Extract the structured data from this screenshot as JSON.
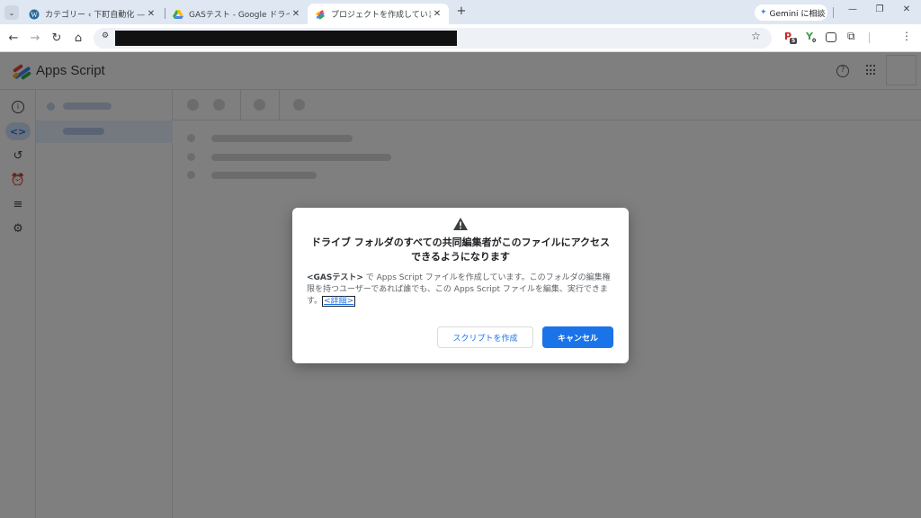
{
  "browser": {
    "tabs": [
      {
        "title": "カテゴリー ‹ 下町自動化 — WordPress",
        "icon": "wordpress-icon",
        "active": false
      },
      {
        "title": "GASテスト - Google ドライブ",
        "icon": "google-drive-icon",
        "active": false
      },
      {
        "title": "プロジェクトを作成しています... - Apps Script",
        "icon": "apps-script-icon",
        "active": true
      }
    ],
    "new_tab_label": "+",
    "gemini_label": "Gemini に相談",
    "extension_badges": {
      "first": "5",
      "second": "0"
    },
    "window_controls": {
      "minimize": "—",
      "restore": "❐",
      "close": "✕"
    }
  },
  "app": {
    "name": "Apps Script",
    "logo_colors": [
      "#4285f4",
      "#ea4335",
      "#fbbc04",
      "#34a853"
    ]
  },
  "dialog": {
    "warning_icon": "warning-icon",
    "title": "ドライブ フォルダのすべての共同編集者がこのファイルにアクセスできるようになります",
    "body_bold": "<GASテスト>",
    "body_text": " で Apps Script ファイルを作成しています。このフォルダの編集権限を持つユーザーであれば誰でも、この Apps Script ファイルを編集、実行できます。",
    "details_link": "<詳細>",
    "create_button": "スクリプトを作成",
    "cancel_button": "キャンセル"
  },
  "colors": {
    "accent": "#1a73e8",
    "tabstrip": "#dfe7f2",
    "overlay": "rgba(0,0,0,0.5)"
  }
}
